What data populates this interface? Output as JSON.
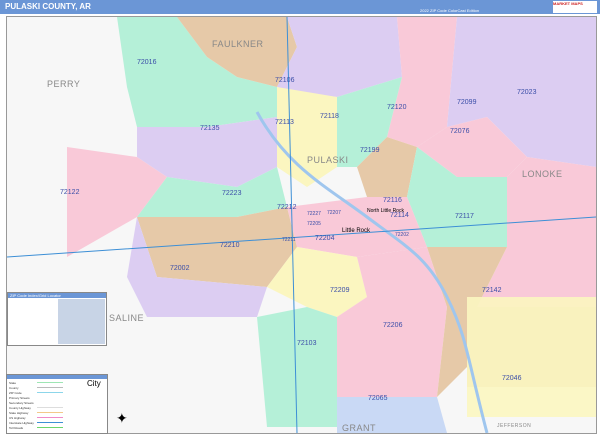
{
  "header": {
    "title": "PULASKI COUNTY, AR",
    "edition": "2022 ZIP Code ColorCast Edition",
    "logo": "MARKET MAPS"
  },
  "counties": [
    "FAULKNER",
    "PERRY",
    "LONOKE",
    "SALINE",
    "GRANT",
    "JEFFERSON",
    "PULASKI"
  ],
  "cities": [
    "Little Rock",
    "North Little Rock"
  ],
  "zips": [
    "72016",
    "72106",
    "72113",
    "72118",
    "72120",
    "72099",
    "72023",
    "72135",
    "72076",
    "72199",
    "72122",
    "72223",
    "72212",
    "72227",
    "72116",
    "72114",
    "72117",
    "72205",
    "72207",
    "72211",
    "72204",
    "72202",
    "72210",
    "72002",
    "72209",
    "72142",
    "72206",
    "72103",
    "72046",
    "72065"
  ],
  "table": {
    "title": "ZIP Code Index/Grid Locator"
  },
  "legend": {
    "items": [
      "State",
      "County",
      "ZIP Code",
      "Primary Streets",
      "Secondary Streets",
      "County Highway",
      "State Highway",
      "US Highway",
      "Interstate Highway",
      "Toll Roads"
    ],
    "city_sample": "City"
  },
  "colors": {
    "header": "#6b96d6",
    "pink": "#f9c9d8",
    "green": "#b5f0d8",
    "purple": "#dccdf2",
    "tan": "#e6c9a8",
    "yellow": "#fbf6c0",
    "blue": "#c9d9f5"
  }
}
